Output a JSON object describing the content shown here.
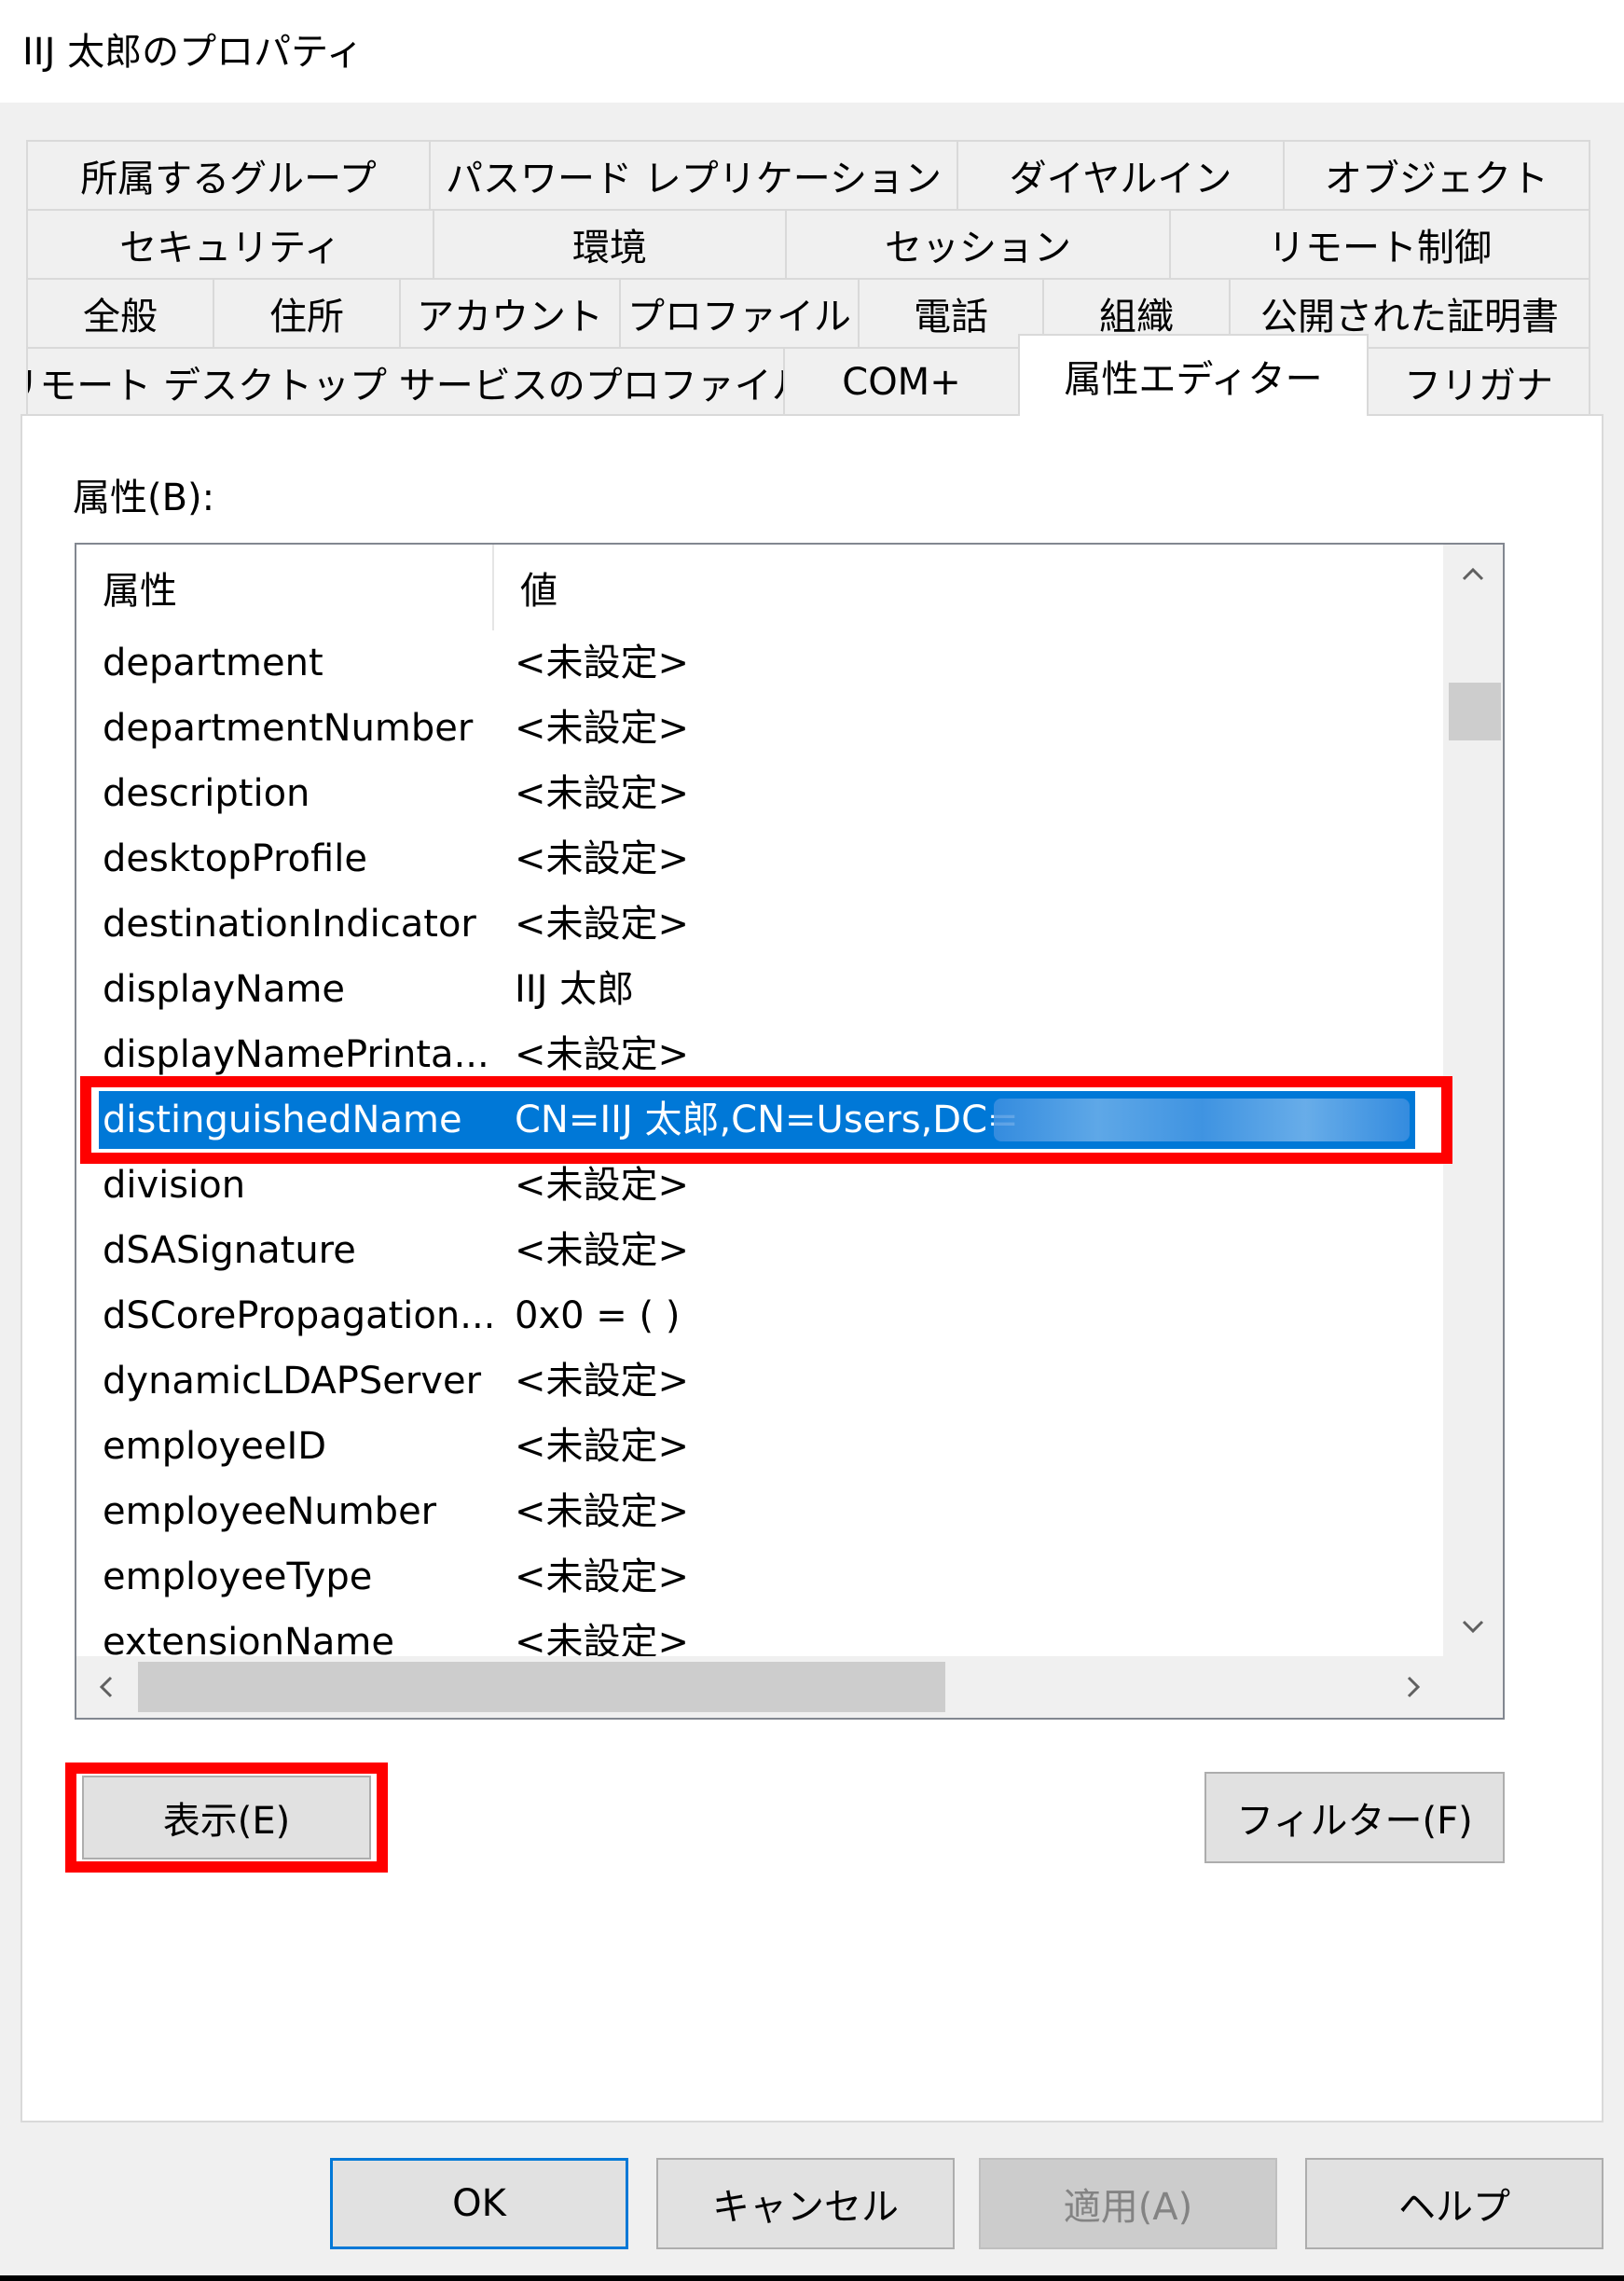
{
  "window": {
    "title": "IIJ 太郎のプロパティ"
  },
  "tabs": {
    "row1": [
      "所属するグループ",
      "パスワード レプリケーション",
      "ダイヤルイン",
      "オブジェクト"
    ],
    "row2": [
      "セキュリティ",
      "環境",
      "セッション",
      "リモート制御"
    ],
    "row3": [
      "全般",
      "住所",
      "アカウント",
      "プロファイル",
      "電話",
      "組織",
      "公開された証明書"
    ],
    "row4": [
      "リモート デスクトップ サービスのプロファイル",
      "COM+",
      "属性エディター",
      "フリガナ"
    ],
    "active": "属性エディター"
  },
  "attributes_label": "属性(B):",
  "list": {
    "columns": [
      "属性",
      "値"
    ],
    "rows": [
      {
        "attr": "department",
        "value": "<未設定>"
      },
      {
        "attr": "departmentNumber",
        "value": "<未設定>"
      },
      {
        "attr": "description",
        "value": "<未設定>"
      },
      {
        "attr": "desktopProfile",
        "value": "<未設定>"
      },
      {
        "attr": "destinationIndicator",
        "value": "<未設定>"
      },
      {
        "attr": "displayName",
        "value": "IIJ 太郎"
      },
      {
        "attr": "displayNamePrinta...",
        "value": "<未設定>"
      },
      {
        "attr": "distinguishedName",
        "value": "CN=IIJ 太郎,CN=Users,DC=",
        "selected": true
      },
      {
        "attr": "division",
        "value": "<未設定>"
      },
      {
        "attr": "dSASignature",
        "value": "<未設定>"
      },
      {
        "attr": "dSCorePropagation...",
        "value": "0x0 = ( )"
      },
      {
        "attr": "dynamicLDAPServer",
        "value": "<未設定>"
      },
      {
        "attr": "employeeID",
        "value": "<未設定>"
      },
      {
        "attr": "employeeNumber",
        "value": "<未設定>"
      },
      {
        "attr": "employeeType",
        "value": "<未設定>"
      },
      {
        "attr": "extensionName",
        "value": "<未設定>"
      }
    ]
  },
  "buttons": {
    "view": "表示(E)",
    "filter": "フィルター(F)",
    "ok": "OK",
    "cancel": "キャンセル",
    "apply": "適用(A)",
    "help": "ヘルプ"
  },
  "colors": {
    "selection": "#0078d7",
    "annotation": "#ff0000"
  }
}
